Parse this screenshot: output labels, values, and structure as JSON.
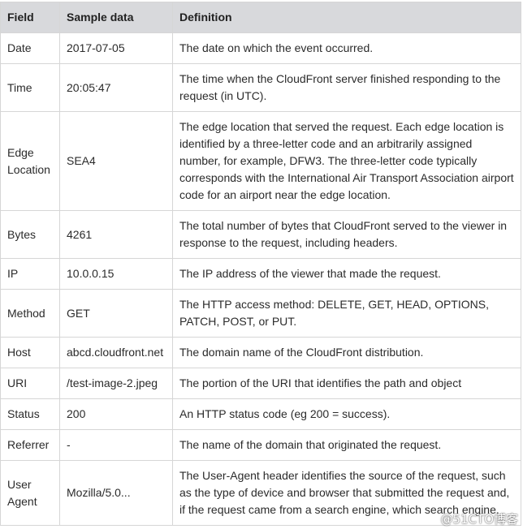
{
  "table": {
    "headers": [
      "Field",
      "Sample data",
      "Definition"
    ],
    "rows": [
      {
        "field": "Date",
        "sample": "2017-07-05",
        "definition": "The date on which the event occurred."
      },
      {
        "field": "Time",
        "sample": "20:05:47",
        "definition": "The time when the CloudFront server finished responding to the request (in UTC)."
      },
      {
        "field": "Edge Location",
        "sample": "SEA4",
        "definition": "The edge location that served the request. Each edge location is identified by a three-letter code and an arbitrarily assigned number, for example, DFW3. The three-letter code typically corresponds with the International Air Transport Association airport code for an airport near the edge location."
      },
      {
        "field": "Bytes",
        "sample": "4261",
        "definition": "The total number of bytes that CloudFront served to the viewer in response to the request, including headers."
      },
      {
        "field": "IP",
        "sample": "10.0.0.15",
        "definition": "The IP address of the viewer that made the request."
      },
      {
        "field": "Method",
        "sample": "GET",
        "definition": "The HTTP access method: DELETE, GET, HEAD, OPTIONS, PATCH, POST, or PUT."
      },
      {
        "field": "Host",
        "sample": "abcd.cloudfront.net",
        "definition": "The domain name of the CloudFront distribution."
      },
      {
        "field": "URI",
        "sample": "/test-image-2.jpeg",
        "definition": "The portion of the URI that identifies the path and object"
      },
      {
        "field": "Status",
        "sample": "200",
        "definition": "An HTTP status code (eg 200 = success)."
      },
      {
        "field": "Referrer",
        "sample": "-",
        "definition": "The name of the domain that originated the request."
      },
      {
        "field": "User Agent",
        "sample": "Mozilla/5.0...",
        "definition": "The User-Agent header identifies the source of the request, such as the type of device and browser that submitted the request and, if the request came from a search engine, which search engine."
      }
    ]
  },
  "watermark": "@51CTO博客"
}
